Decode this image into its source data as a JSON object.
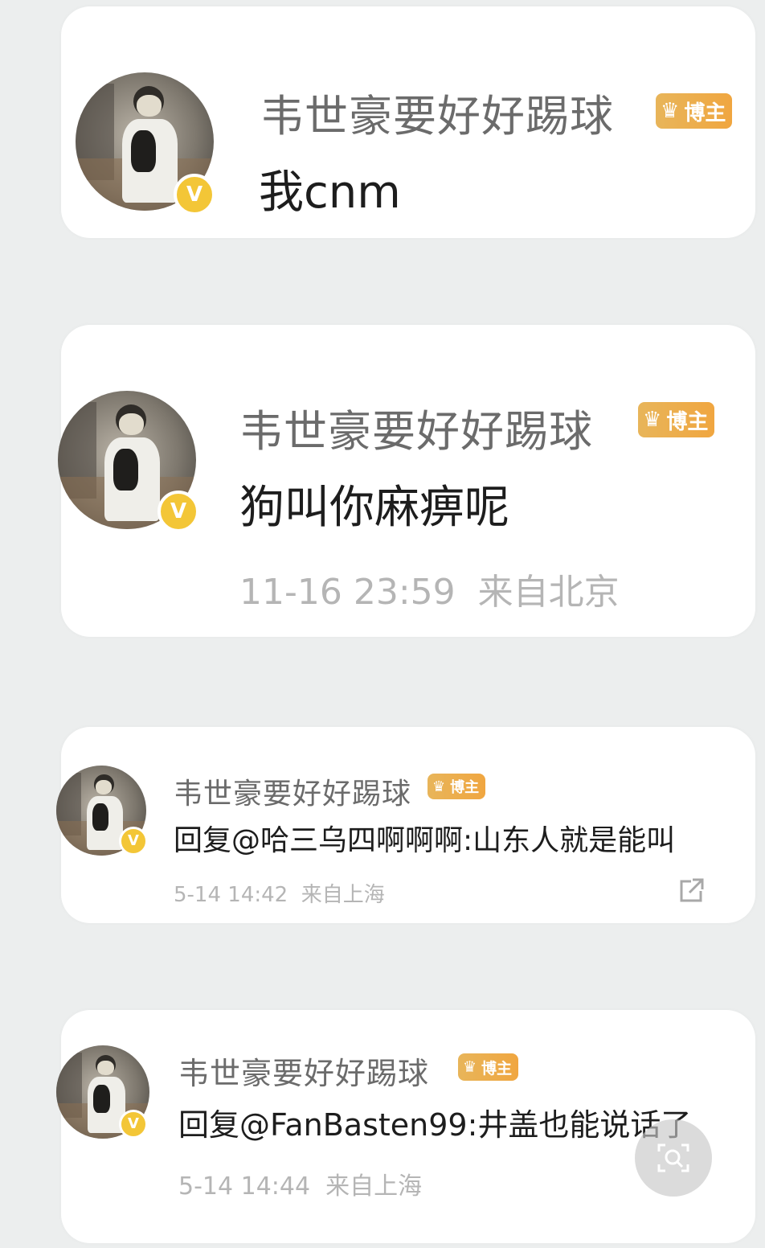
{
  "comments": [
    {
      "username": "韦世豪要好好踢球",
      "badge": "博主",
      "text": "我cnm",
      "meta": ""
    },
    {
      "username": "韦世豪要好好踢球",
      "badge": "博主",
      "text": "狗叫你麻痹呢",
      "meta": "11-16 23:59  来自北京"
    },
    {
      "username": "韦世豪要好好踢球",
      "badge": "博主",
      "text": "回复@哈三乌四啊啊啊:山东人就是能叫",
      "meta": "5-14 14:42  来自上海"
    },
    {
      "username": "韦世豪要好好踢球",
      "badge": "博主",
      "text": "回复@FanBasten99:井盖也能说话了",
      "meta": "5-14 14:44  来自上海"
    }
  ],
  "icons": {
    "verified": "verified-v-icon",
    "crown": "crown-icon",
    "share": "share-external-icon",
    "lens": "image-search-icon"
  },
  "colors": {
    "background": "#eceeee",
    "card": "#ffffff",
    "badge_gold": "#f0a640",
    "verified_yellow": "#f3c637"
  }
}
